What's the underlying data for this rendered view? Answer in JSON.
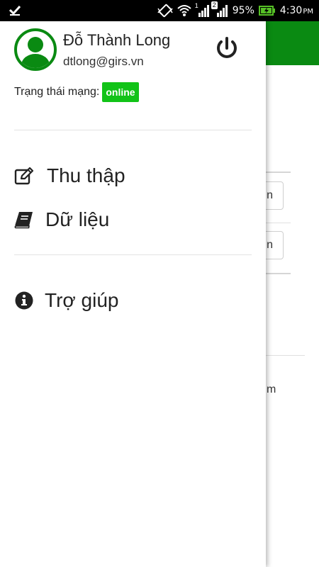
{
  "status_bar": {
    "battery_percent": "95%",
    "time": "4:30",
    "time_suffix": "PM",
    "notification_count": "2",
    "signal_label_1": "1",
    "icons": [
      "check-icon",
      "vibrate-icon",
      "wifi-icon",
      "signal-icon",
      "signal-icon",
      "battery-charging-icon"
    ]
  },
  "user": {
    "name": "Đỗ Thành Long",
    "email": "dtlong@girs.vn"
  },
  "network": {
    "label": "Trạng thái mạng:",
    "status": "online"
  },
  "menu": {
    "items": [
      {
        "label": "Thu thập",
        "icon": "edit-icon"
      },
      {
        "label": "Dữ liệu",
        "icon": "book-icon"
      },
      {
        "label": "Trợ giúp",
        "icon": "info-icon"
      }
    ]
  },
  "background": {
    "button_1_text": "n",
    "button_2_text": "n",
    "trailing_text": "m"
  },
  "colors": {
    "header_green": "#0a8a12",
    "badge_green": "#12c318",
    "avatar_green": "#0a8a12"
  }
}
